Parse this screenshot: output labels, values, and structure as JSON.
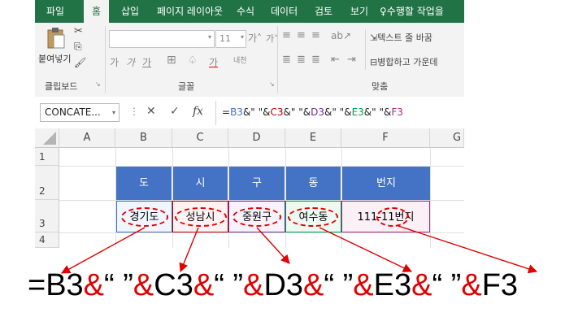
{
  "ribbon": {
    "tabs": [
      "파일",
      "홈",
      "삽입",
      "페이지 레이아웃",
      "수식",
      "데이터",
      "검토",
      "보기"
    ],
    "active_tab": "홈",
    "tell_me": "수행할 작업을",
    "clipboard": {
      "paste_label": "붙여넣기",
      "group_label": "클립보드"
    },
    "font": {
      "size": "11",
      "group_label": "글꼴",
      "bold": "가",
      "italic": "가",
      "underline": "가",
      "font_color_letter": "가"
    },
    "alignment": {
      "group_label": "맞춤",
      "wrap_text": "텍스트 줄 바꿈",
      "merge_center": "병합하고 가운데"
    }
  },
  "formula_bar": {
    "name_box": "CONCATE...",
    "cancel": "✕",
    "enter": "✓",
    "fx": "fx",
    "formula_parts": [
      {
        "t": "=",
        "c": "#222222"
      },
      {
        "t": "B3",
        "c": "#4472c4"
      },
      {
        "t": "&\" \"&",
        "c": "#222222"
      },
      {
        "t": "C3",
        "c": "#c00000"
      },
      {
        "t": "&\" \"&",
        "c": "#222222"
      },
      {
        "t": "D3",
        "c": "#7030a0"
      },
      {
        "t": "&\" \"&",
        "c": "#222222"
      },
      {
        "t": "E3",
        "c": "#00a050"
      },
      {
        "t": "&\" \"&",
        "c": "#222222"
      },
      {
        "t": "F3",
        "c": "#a0307a"
      }
    ]
  },
  "sheet": {
    "columns": [
      "A",
      "B",
      "C",
      "D",
      "E",
      "F",
      "G"
    ],
    "rows": [
      "1",
      "2",
      "3",
      "4"
    ],
    "header_row": [
      "도",
      "시",
      "구",
      "동",
      "번지"
    ],
    "data_row": [
      "경기도",
      "성남시",
      "중원구",
      "여수동",
      "111-11번지"
    ],
    "header_fill": "#4472c4"
  },
  "big_formula": {
    "parts": [
      {
        "t": "=B3",
        "amp": false
      },
      {
        "t": "&",
        "amp": true
      },
      {
        "t": "“ ”",
        "amp": false
      },
      {
        "t": "&",
        "amp": true
      },
      {
        "t": "C3",
        "amp": false
      },
      {
        "t": "&",
        "amp": true
      },
      {
        "t": "“ ”",
        "amp": false
      },
      {
        "t": "&",
        "amp": true
      },
      {
        "t": "D3",
        "amp": false
      },
      {
        "t": "&",
        "amp": true
      },
      {
        "t": "“ ”",
        "amp": false
      },
      {
        "t": "&",
        "amp": true
      },
      {
        "t": "E3",
        "amp": false
      },
      {
        "t": "&",
        "amp": true
      },
      {
        "t": "“ ”",
        "amp": false
      },
      {
        "t": "&",
        "amp": true
      },
      {
        "t": "F3",
        "amp": false
      }
    ],
    "accent_color": "#e00000"
  }
}
